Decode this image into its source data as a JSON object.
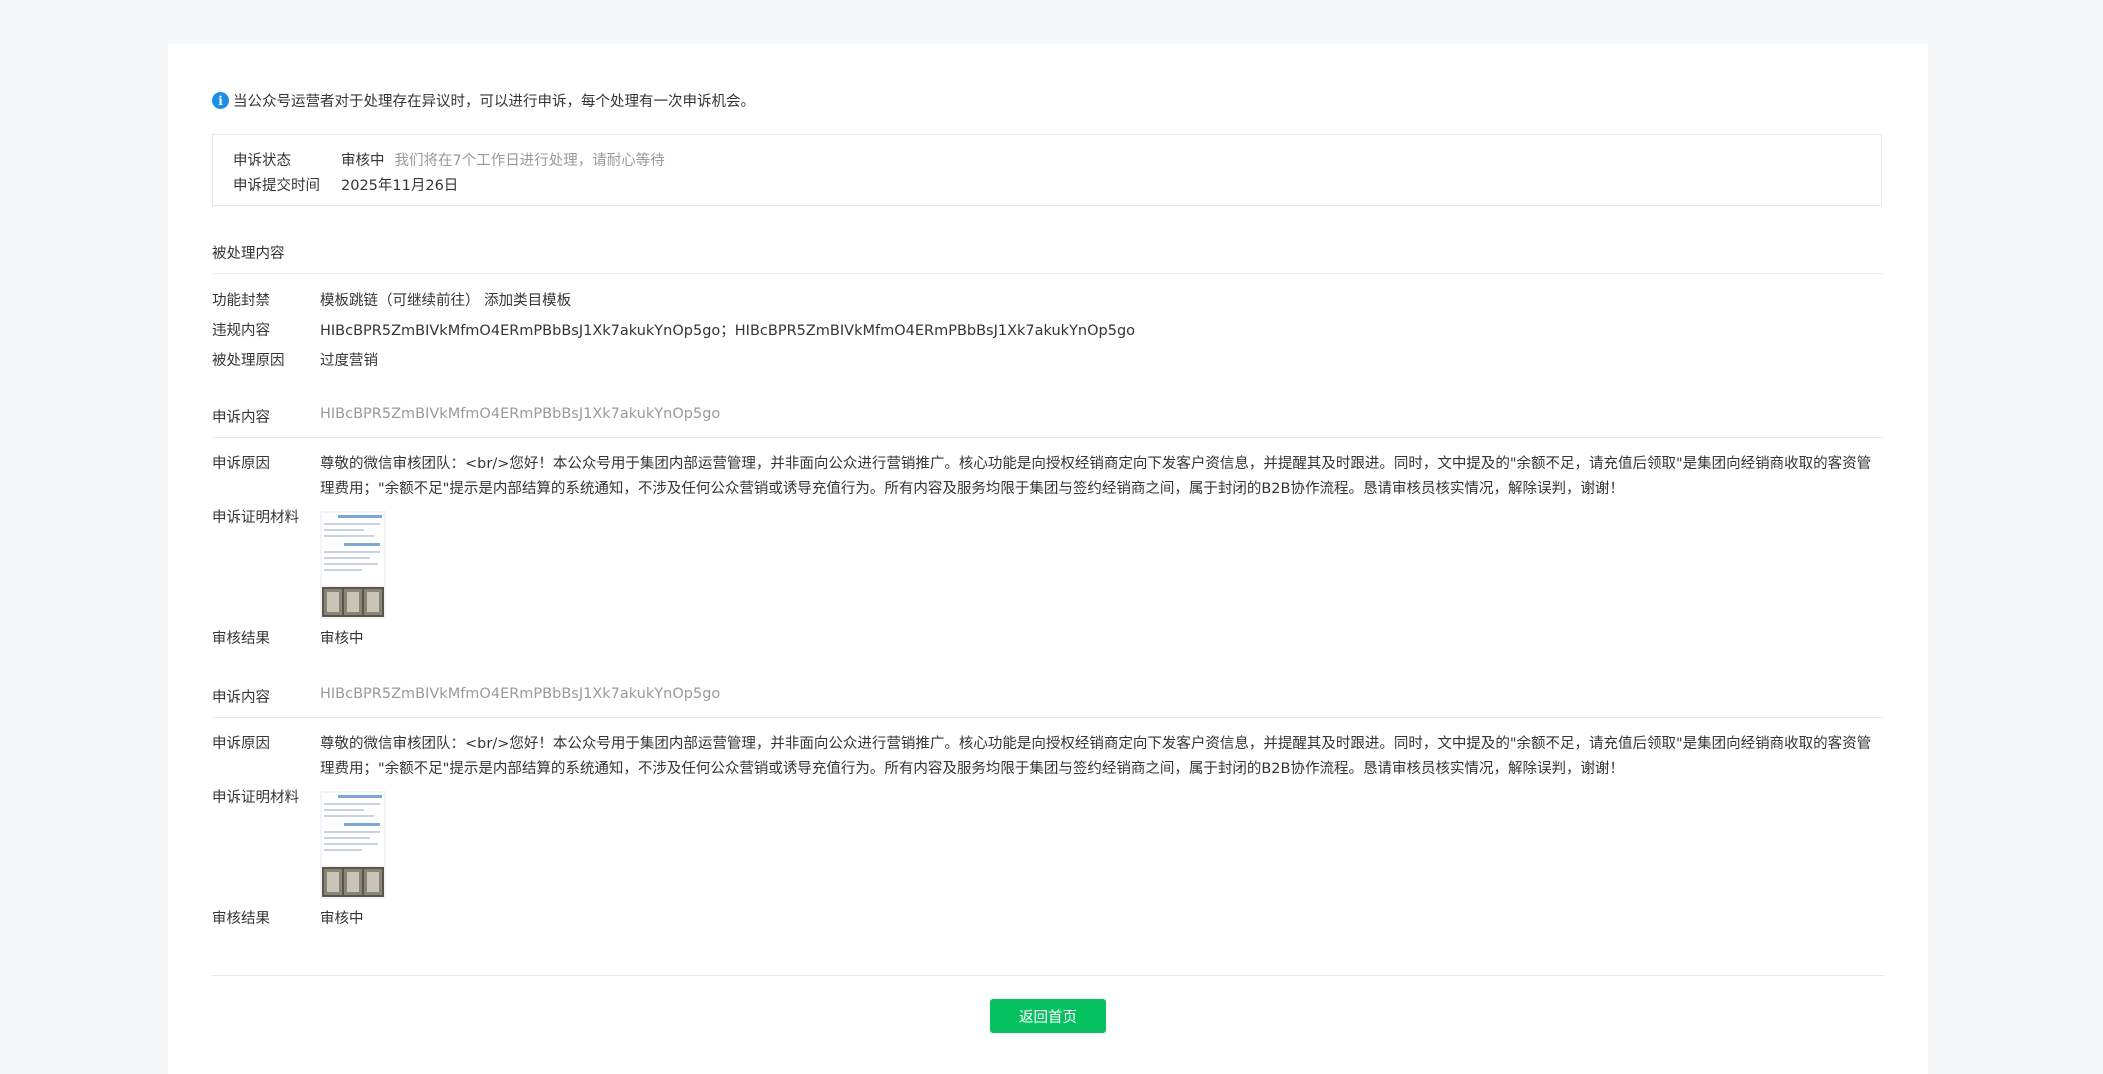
{
  "notice": {
    "text": "当公众号运营者对于处理存在异议时，可以进行申诉，每个处理有一次申诉机会。"
  },
  "status": {
    "state_label": "申诉状态",
    "state_value": "审核中",
    "state_tip": "我们将在7个工作日进行处理，请耐心等待",
    "time_label": "申诉提交时间",
    "time_value": "2025年11月26日"
  },
  "processed": {
    "title": "被处理内容",
    "rows": [
      {
        "label": "功能封禁",
        "value": "模板跳链（可继续前往） 添加类目模板"
      },
      {
        "label": "违规内容",
        "value": "HIBcBPR5ZmBIVkMfmO4ERmPBbBsJ1Xk7akukYnOp5go；HIBcBPR5ZmBIVkMfmO4ERmPBbBsJ1Xk7akukYnOp5go"
      },
      {
        "label": "被处理原因",
        "value": "过度营销"
      }
    ]
  },
  "appeals": [
    {
      "content_label": "申诉内容",
      "content_value": "HIBcBPR5ZmBIVkMfmO4ERmPBbBsJ1Xk7akukYnOp5go",
      "reason_label": "申诉原因",
      "reason_value": "尊敬的微信审核团队：<br/>您好！本公众号用于集团内部运营管理，并非面向公众进行营销推广。核心功能是向授权经销商定向下发客户资信息，并提醒其及时跟进。同时，文中提及的\"余额不足，请充值后领取\"是集团向经销商收取的客资管理费用；\"余额不足\"提示是内部结算的系统通知，不涉及任何公众营销或诱导充值行为。所有内容及服务均限于集团与签约经销商之间，属于封闭的B2B协作流程。恳请审核员核实情况，解除误判，谢谢！",
      "proof_label": "申诉证明材料",
      "result_label": "审核结果",
      "result_value": "审核中"
    },
    {
      "content_label": "申诉内容",
      "content_value": "HIBcBPR5ZmBIVkMfmO4ERmPBbBsJ1Xk7akukYnOp5go",
      "reason_label": "申诉原因",
      "reason_value": "尊敬的微信审核团队：<br/>您好！本公众号用于集团内部运营管理，并非面向公众进行营销推广。核心功能是向授权经销商定向下发客户资信息，并提醒其及时跟进。同时，文中提及的\"余额不足，请充值后领取\"是集团向经销商收取的客资管理费用；\"余额不足\"提示是内部结算的系统通知，不涉及任何公众营销或诱导充值行为。所有内容及服务均限于集团与签约经销商之间，属于封闭的B2B协作流程。恳请审核员核实情况，解除误判，谢谢！",
      "proof_label": "申诉证明材料",
      "result_label": "审核结果",
      "result_value": "审核中"
    }
  ],
  "footer": {
    "back_label": "返回首页"
  },
  "colors": {
    "accent_green": "#07c160",
    "info_blue": "#1d8fe6",
    "muted_text": "#9a9a9a",
    "border": "#e7e7eb"
  },
  "icons": {
    "notice": "info-icon"
  }
}
